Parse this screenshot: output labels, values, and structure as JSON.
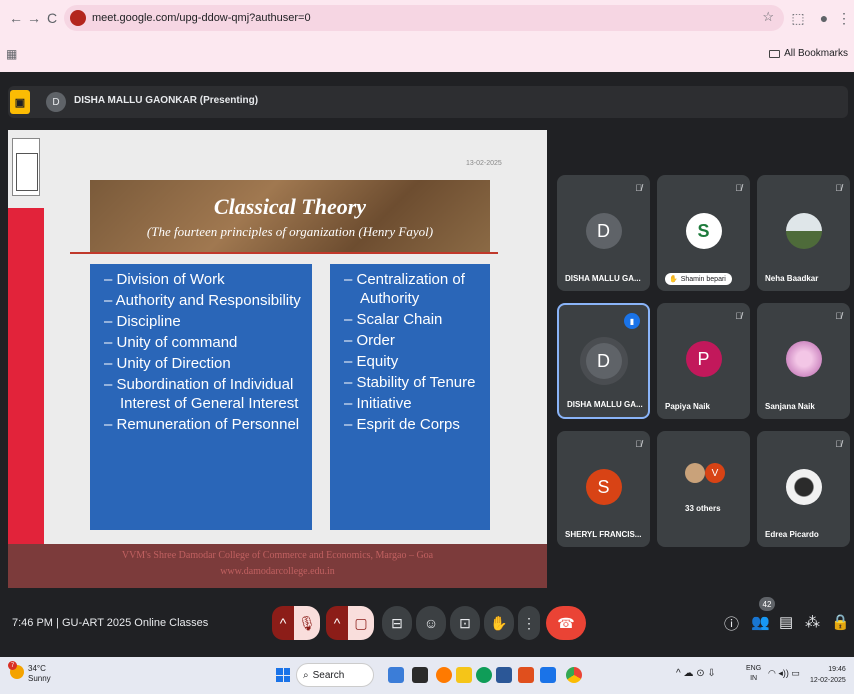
{
  "browser": {
    "url": "meet.google.com/upg-ddow-qmj?authuser=0",
    "bookmarks_label": "All Bookmarks",
    "nav": {
      "back": "←",
      "forward": "→",
      "reload": "C"
    }
  },
  "meet": {
    "presenter_label": "DISHA MALLU GAONKAR (Presenting)",
    "presenter_initial": "D",
    "slide": {
      "date": "13-02-2025",
      "title": "Classical Theory",
      "subtitle": "(The fourteen principles of organization (Henry Fayol)",
      "left_items": [
        "– Division of Work",
        "– Authority and Responsibility",
        "– Discipline",
        "– Unity of command",
        "– Unity of Direction",
        "– Subordination of Individual Interest of General Interest",
        "– Remuneration of Personnel"
      ],
      "right_items": [
        "– Centralization of Authority",
        "– Scalar Chain",
        "– Order",
        "– Equity",
        "– Stability of Tenure",
        "– Initiative",
        "– Esprit de Corps"
      ],
      "footer_line1": "VVM's Shree Damodar College of Commerce and Economics, Margao – Goa",
      "footer_line2": "www.damodarcollege.edu.in"
    },
    "participants": [
      {
        "name": "DISHA MALLU GA...",
        "initial": "D",
        "color": "#5f6368"
      },
      {
        "name": "Shamin bepari",
        "initial": "S",
        "color": "#ffffff"
      },
      {
        "name": "Neha Baadkar",
        "initial": "",
        "color": "#6b7b5a"
      },
      {
        "name": "DISHA MALLU GA...",
        "initial": "D",
        "color": "#5f6368"
      },
      {
        "name": "Papiya Naik",
        "initial": "P",
        "color": "#c2185b"
      },
      {
        "name": "Sanjana Naik",
        "initial": "",
        "color": "#e8b4d8"
      },
      {
        "name": "SHERYL FRANCIS...",
        "initial": "S",
        "color": "#d84315"
      },
      {
        "name": "33 others",
        "initial": "V",
        "color": "#d84315"
      },
      {
        "name": "Edrea Picardo",
        "initial": "",
        "color": "#f1f1f1"
      }
    ],
    "footer": {
      "time": "7:46 PM",
      "separator": "|",
      "meeting_name": "GU-ART 2025 Online Classes",
      "people_count": "42"
    }
  },
  "taskbar": {
    "temperature": "34°C",
    "condition": "Sunny",
    "weather_badge": "7",
    "search_placeholder": "Search",
    "lang_line1": "ENG",
    "lang_line2": "IN",
    "time": "19:46",
    "date": "12-02-2025"
  }
}
